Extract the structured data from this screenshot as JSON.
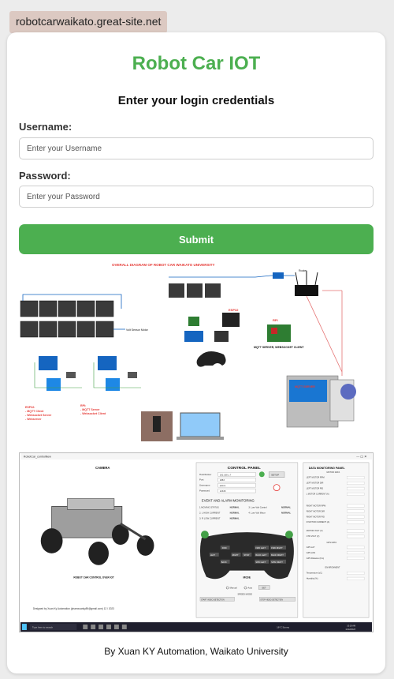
{
  "browser": {
    "site_url": "robotcarwaikato.great-site.net"
  },
  "login": {
    "title": "Robot Car IOT",
    "subtitle": "Enter your login credentials",
    "username_label": "Username:",
    "username_placeholder": "Enter your Username",
    "password_label": "Password:",
    "password_placeholder": "Enter your Password",
    "submit_label": "Submit"
  },
  "diagram": {
    "heading": "OVERALL DIAGRAM OF ROBOT CAR WAIKATO UNIVERSITY",
    "labels": {
      "volt_sensor": "Volt Sensor Motor",
      "esp32": "ESP32",
      "rpi": "RPI",
      "mqtt_server": "MQTT SERVER, WEBSOCKET CLIENT",
      "mqtt_server_pc": "MQTT SERVER",
      "esp32_notes": [
        "ESP32:",
        "- MQTT Client",
        "- Websocket Server",
        "- Webserver"
      ],
      "rpi_notes": [
        "RPI:",
        "- MQTT Server",
        "- Websocket Client"
      ],
      "router": "Router"
    }
  },
  "app_window": {
    "window_title": "RobotCar_controlNew",
    "camera_label": "CAMERA",
    "robot_caption": "ROBOT CAR CONTROL OVER IOT",
    "designer_credit": "Designed by Xuan Ky Automation (phamxuanky89@gmail.com) 12 / 2023",
    "control_panel": {
      "title": "CONTROL PANEL",
      "fields": [
        "Host/broker",
        "Port",
        "Username",
        "Password"
      ],
      "values": [
        "192.168.1.7",
        "1883",
        "admin",
        "12345"
      ],
      "setup_button": "SETUP"
    },
    "event_monitor": {
      "title": "EVENT AND ALARM MONITORING",
      "rows": [
        [
          "1.MOVING STATUS",
          "NORMAL",
          "3. Low Volt Control",
          "NORMAL"
        ],
        [
          "2. L HIGH CURRENT",
          "NORMAL",
          "4. Low Volt Motor",
          "NORMAL"
        ],
        [
          "3. R LOW CURRENT",
          "NORMAL",
          "",
          ""
        ]
      ]
    },
    "gamepad": {
      "buttons": [
        "FWD",
        "BACK",
        "LEFT",
        "RIGHT",
        "STOP",
        "FWD LEFT",
        "FWD RIGHT",
        "BACK LEFT",
        "BACK RIGHT",
        "SPIN LEFT",
        "SPIN RIGHT"
      ],
      "mode_label": "MODE",
      "manual_label": "Manual",
      "auto_label": "Auto",
      "set_button": "SET",
      "speed_label": "SPEED MODE",
      "video_start": "START VIDEO DETECTION",
      "video_stop": "STOP VIDEO DETECTION"
    },
    "data_panel": {
      "title": "DATA MONITORING PANEL",
      "motor_section": "MOTOR DATA",
      "rows": [
        "LEFT MOTOR RPM",
        "LEFT MOTOR DIR",
        "LEFT MOTOR PID",
        "L MOTOR CURRENT (A)",
        "RIGHT MOTOR RPM",
        "RIGHT MOTOR DIR",
        "RIGHT MOTOR PID",
        "R MOTOR CURRENT (A)",
        "MOTOR VOLT (V)",
        "CTR VOLT (V)"
      ],
      "gps_section": "GPS DATA",
      "gps_rows": [
        "GPS LAT",
        "GPS LON",
        "GPS Distance (Km)"
      ],
      "env_section": "ENVIRONMENT",
      "env_rows": [
        "Temperature (oC)",
        "Humidity (%)"
      ]
    },
    "taskbar": {
      "search": "Type here to search",
      "weather": "16°C Sunny",
      "time": "10:18 AM",
      "date": "11/12/2023"
    }
  },
  "footer": {
    "text": "By Xuan KY Automation, Waikato University"
  },
  "colors": {
    "accent": "#4caf50",
    "tab_bg": "#dcc9c2",
    "page_bg": "#ececec"
  }
}
